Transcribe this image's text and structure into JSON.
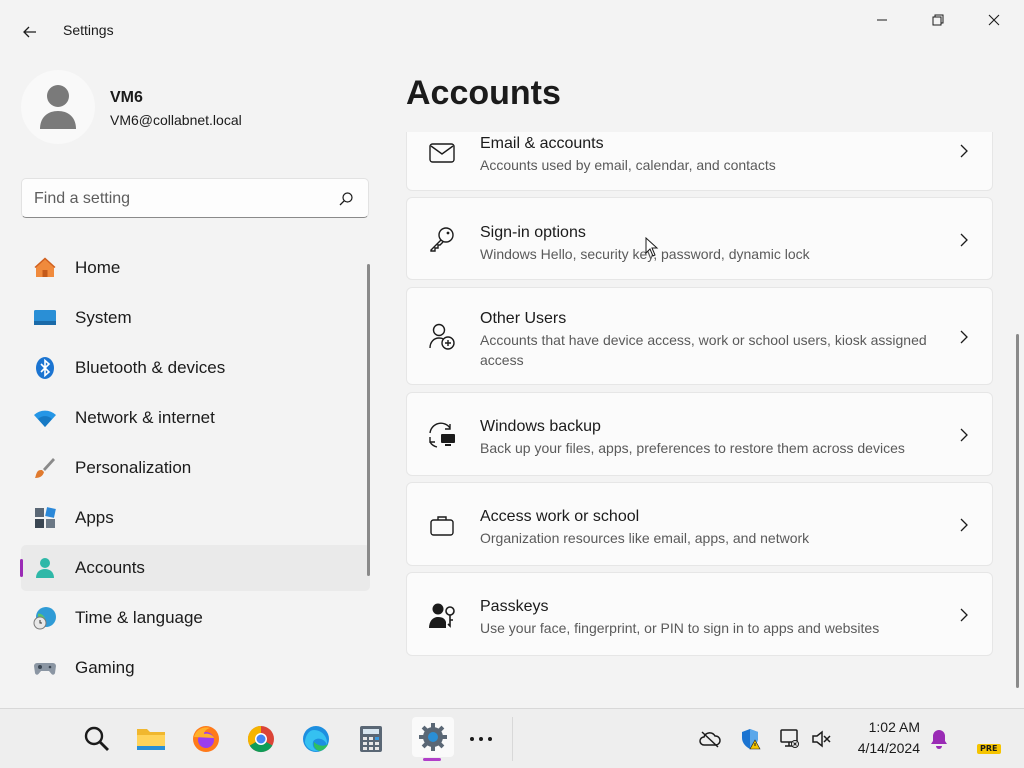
{
  "window": {
    "title": "Settings"
  },
  "profile": {
    "name": "VM6",
    "email": "VM6@collabnet.local"
  },
  "search": {
    "placeholder": "Find a setting"
  },
  "page": {
    "title": "Accounts"
  },
  "nav": {
    "items": [
      {
        "label": "Home",
        "icon": "home-icon"
      },
      {
        "label": "System",
        "icon": "system-icon"
      },
      {
        "label": "Bluetooth & devices",
        "icon": "bluetooth-icon"
      },
      {
        "label": "Network & internet",
        "icon": "wifi-icon"
      },
      {
        "label": "Personalization",
        "icon": "brush-icon"
      },
      {
        "label": "Apps",
        "icon": "apps-icon"
      },
      {
        "label": "Accounts",
        "icon": "accounts-icon",
        "selected": true
      },
      {
        "label": "Time & language",
        "icon": "globe-clock-icon"
      },
      {
        "label": "Gaming",
        "icon": "gamepad-icon"
      }
    ]
  },
  "cards": [
    {
      "title": "Email & accounts",
      "desc": "Accounts used by email, calendar, and contacts",
      "icon": "mail-icon"
    },
    {
      "title": "Sign-in options",
      "desc": "Windows Hello, security key, password, dynamic lock",
      "icon": "key-icon"
    },
    {
      "title": "Other Users",
      "desc": "Accounts that have device access, work or school users, kiosk assigned access",
      "icon": "add-user-icon"
    },
    {
      "title": "Windows backup",
      "desc": "Back up your files, apps, preferences to restore them across devices",
      "icon": "backup-icon"
    },
    {
      "title": "Access work or school",
      "desc": "Organization resources like email, apps, and network",
      "icon": "briefcase-icon"
    },
    {
      "title": "Passkeys",
      "desc": "Use your face, fingerprint, or PIN to sign in to apps and websites",
      "icon": "passkey-icon"
    }
  ],
  "taskbar": {
    "apps": [
      "search-icon",
      "file-explorer-icon",
      "firefox-icon",
      "chrome-icon",
      "edge-icon",
      "calculator-icon",
      "settings-icon",
      "more-icon"
    ],
    "active": "settings-icon"
  },
  "tray": {
    "time": "1:02 AM",
    "date": "4/14/2024",
    "badge": "PRE"
  },
  "colors": {
    "accent": "#9a2bb5",
    "background": "#f3f3f3",
    "card": "#fbfbfb"
  }
}
